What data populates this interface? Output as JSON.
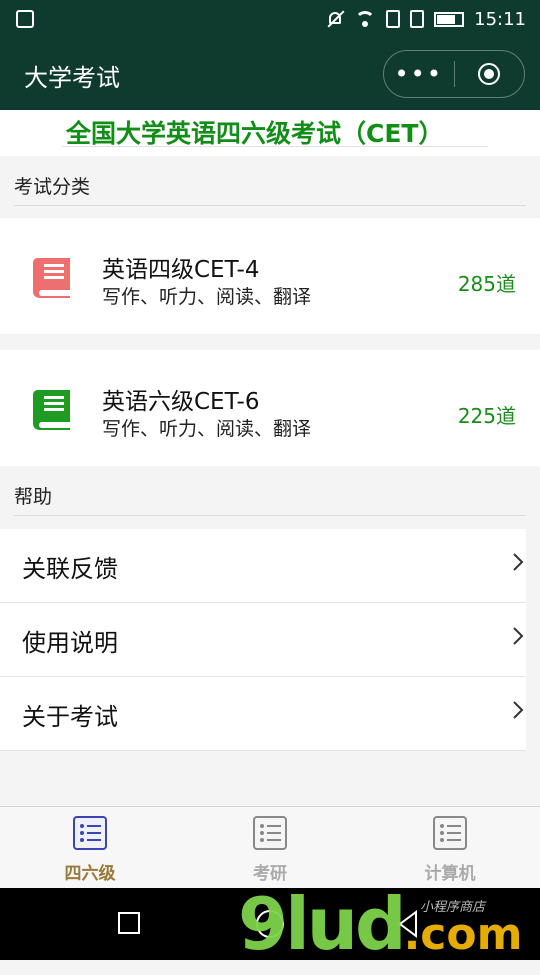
{
  "status_bar": {
    "time": "15:11"
  },
  "nav": {
    "title": "大学考试",
    "more_label": "•••"
  },
  "banner": {
    "title": "全国大学英语四六级考试（CET）"
  },
  "section_exam": {
    "label": "考试分类"
  },
  "exams": [
    {
      "name": "英语四级CET-4",
      "desc": "写作、听力、阅读、翻译",
      "count": "285道",
      "icon_color": "#ee6f6f"
    },
    {
      "name": "英语六级CET-6",
      "desc": "写作、听力、阅读、翻译",
      "count": "225道",
      "icon_color": "#1f9a23"
    }
  ],
  "section_help": {
    "label": "帮助"
  },
  "help_items": [
    {
      "label": "关联反馈"
    },
    {
      "label": "使用说明"
    },
    {
      "label": "关于考试"
    }
  ],
  "tabs": [
    {
      "label": "四六级",
      "active": true
    },
    {
      "label": "考研",
      "active": false
    },
    {
      "label": "计算机",
      "active": false
    }
  ],
  "colors": {
    "header_bg": "#0f3b2e",
    "accent_green": "#118d18",
    "tab_active": "#9a7a3a",
    "tab_inactive": "#aaaaaa"
  },
  "watermark": {
    "brand": "9lud",
    "suffix": ".com",
    "slogan": "小程序商店"
  }
}
